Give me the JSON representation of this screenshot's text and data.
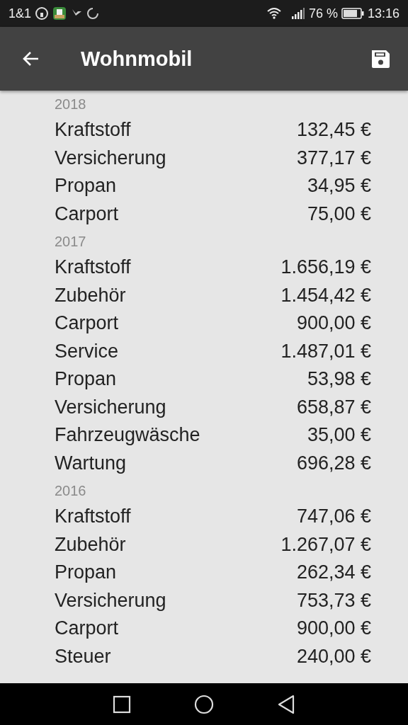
{
  "status_bar": {
    "carrier": "1&1",
    "battery": "76 %",
    "time": "13:16"
  },
  "app_bar": {
    "title": "Wohnmobil"
  },
  "groups": [
    {
      "year": "2018",
      "rows": [
        {
          "label": "Kraftstoff",
          "amount": "132,45 €"
        },
        {
          "label": "Versicherung",
          "amount": "377,17 €"
        },
        {
          "label": "Propan",
          "amount": "34,95 €"
        },
        {
          "label": "Carport",
          "amount": "75,00 €"
        }
      ]
    },
    {
      "year": "2017",
      "rows": [
        {
          "label": "Kraftstoff",
          "amount": "1.656,19 €"
        },
        {
          "label": "Zubehör",
          "amount": "1.454,42 €"
        },
        {
          "label": "Carport",
          "amount": "900,00 €"
        },
        {
          "label": "Service",
          "amount": "1.487,01 €"
        },
        {
          "label": "Propan",
          "amount": "53,98 €"
        },
        {
          "label": "Versicherung",
          "amount": "658,87 €"
        },
        {
          "label": "Fahrzeugwäsche",
          "amount": "35,00 €"
        },
        {
          "label": "Wartung",
          "amount": "696,28 €"
        }
      ]
    },
    {
      "year": "2016",
      "rows": [
        {
          "label": "Kraftstoff",
          "amount": "747,06 €"
        },
        {
          "label": "Zubehör",
          "amount": "1.267,07 €"
        },
        {
          "label": "Propan",
          "amount": "262,34 €"
        },
        {
          "label": "Versicherung",
          "amount": "753,73 €"
        },
        {
          "label": "Carport",
          "amount": "900,00 €"
        },
        {
          "label": "Steuer",
          "amount": "240,00 €"
        }
      ]
    }
  ]
}
